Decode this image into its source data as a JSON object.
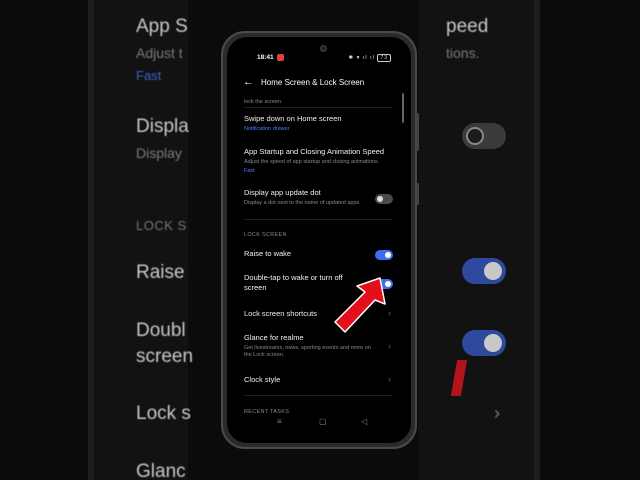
{
  "status_bar": {
    "time": "18:41",
    "indicators": "✱ ▾ ıl ıl",
    "battery": "73"
  },
  "header": {
    "title": "Home Screen & Lock Screen"
  },
  "items": {
    "prev_cut": "lock the screen.",
    "swipe_down": {
      "label": "Swipe down on Home screen",
      "value": "Notification drawer"
    },
    "app_speed": {
      "label": "App Startup and Closing Animation Speed",
      "sub": "Adjust the speed of app startup and closing animations.",
      "value": "Fast"
    },
    "update_dot": {
      "label": "Display app update dot",
      "sub": "Display a dot next to the name of updated apps.",
      "enabled": false
    },
    "lock_section": "LOCK SCREEN",
    "raise_wake": {
      "label": "Raise to wake",
      "enabled": true
    },
    "double_tap": {
      "label": "Double-tap to wake or turn off screen",
      "enabled": true
    },
    "shortcuts": {
      "label": "Lock screen shortcuts"
    },
    "glance": {
      "label": "Glance for realme",
      "sub": "Get livestreams, news, sporting events and more on the Lock screen."
    },
    "clock": {
      "label": "Clock style"
    },
    "recent_section": "RECENT TASKS"
  },
  "background": {
    "app_s": "App S",
    "peed": "peed",
    "adjust_t": "Adjust t",
    "tions": "tions.",
    "fast": "Fast",
    "displ": "Displa",
    "display": "Display",
    "lock_s": "LOCK S",
    "raise": "Raise",
    "doubl": "Doubl",
    "screen": "screen",
    "lock": "Lock s",
    "glanc": "Glanc"
  },
  "icons": {
    "back": "arrow-left-icon",
    "chevron": "chevron-right-icon",
    "arrow": "red-pointer-arrow"
  },
  "colors": {
    "accent": "#3b6ef0",
    "pointer": "#e3101b"
  }
}
